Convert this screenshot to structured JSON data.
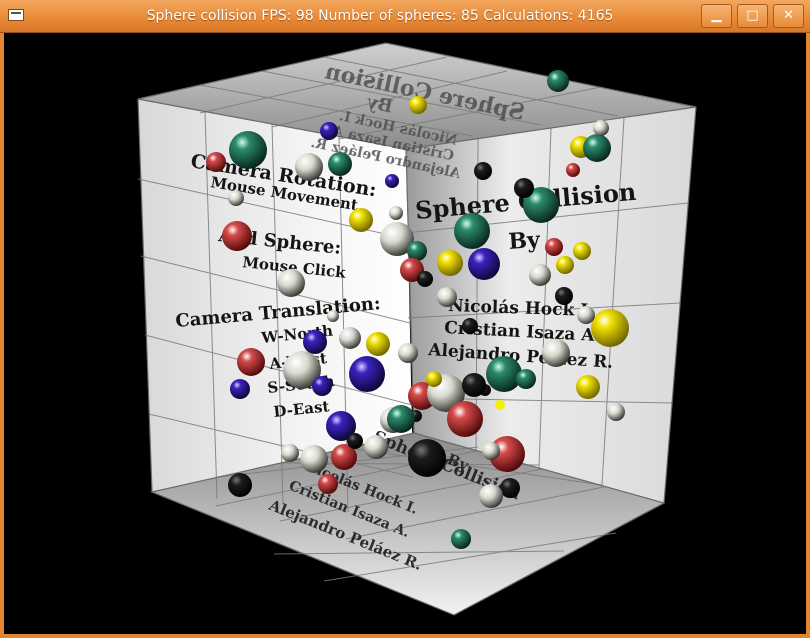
{
  "window": {
    "title": "Sphere collision FPS: 98 Number of spheres: 85 Calculations: 4165",
    "buttons": {
      "minimize": "▁",
      "maximize": "□",
      "close": "✕"
    }
  },
  "scene": {
    "fps": 98,
    "number_of_spheres": 85,
    "calculations": 4165,
    "left_wall": {
      "camera_rotation": "Camera Rotation:",
      "mouse_movement": "Mouse Movement",
      "add_sphere": "Add Sphere:",
      "mouse_click": "Mouse Click",
      "camera_translation": "Camera Translation:",
      "w": "W-North",
      "a": "A-West",
      "s": "S-South",
      "d": "D-East"
    },
    "right_wall": {
      "title": "Sphere Collision",
      "by": "By",
      "author1": "Nicolás Hock I.",
      "author2": "Cristian Isaza A.",
      "author3": "Alejandro Peláez R."
    },
    "floor": {
      "title": "Sphere Collision",
      "by": "By",
      "author1": "Nicolás Hock I.",
      "author2": "Cristian Isaza A.",
      "author3": "Alejandro Peláez R."
    },
    "ceiling": {
      "title": "Sphere Collision",
      "by": "By",
      "author1": "Nicolás Hock I.",
      "author2": "Cristian Isaza A.",
      "author3": "Alejandro Peláez R."
    },
    "sphere_colors": {
      "red": "#b01818",
      "yellow": "#e3d400",
      "teal": "#1f6b55",
      "blue": "#2a1a9a",
      "white": "#e8e8e0",
      "black": "#101010"
    }
  }
}
